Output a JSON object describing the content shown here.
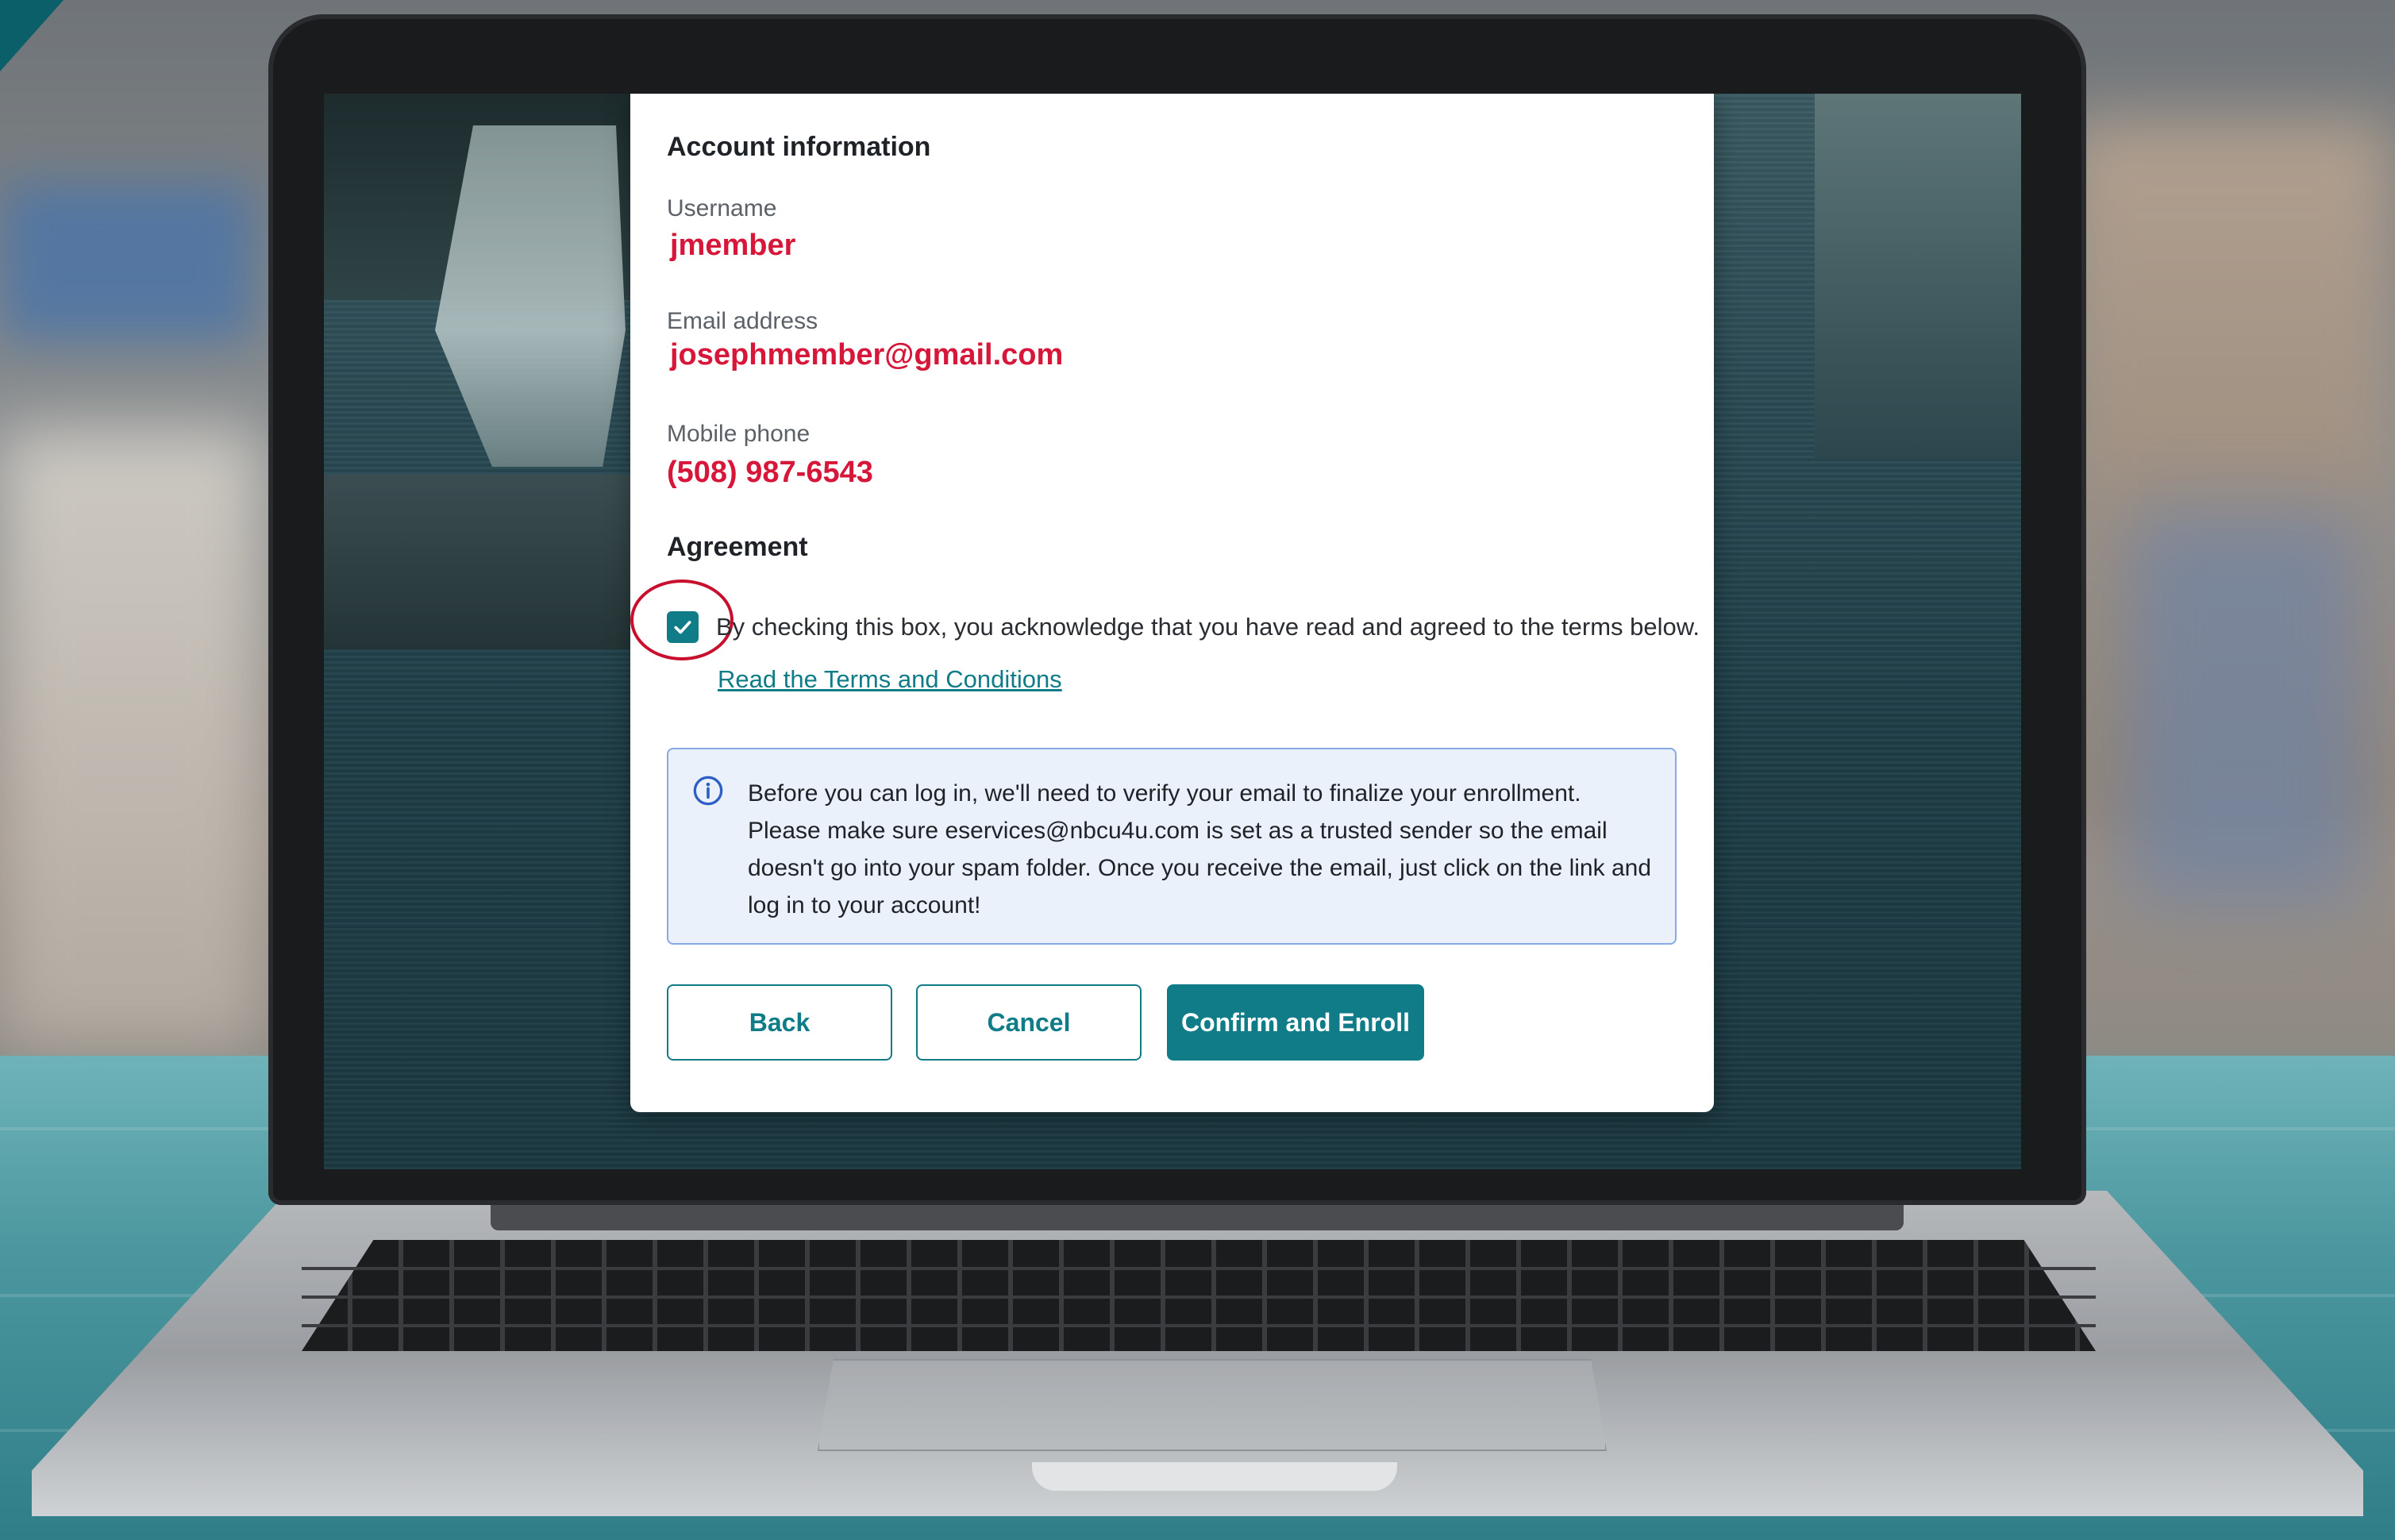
{
  "account": {
    "section_title": "Account information",
    "username_label": "Username",
    "username_value": "jmember",
    "email_label": "Email address",
    "email_value": "josephmember@gmail.com",
    "phone_label": "Mobile phone",
    "phone_value": "(508) 987-6543"
  },
  "agreement": {
    "section_title": "Agreement",
    "checkbox_checked": true,
    "checkbox_text": "By checking this box, you acknowledge that you have read and agreed to the terms below.",
    "terms_link": "Read the Terms and Conditions"
  },
  "info_notice": {
    "icon": "info-icon",
    "text": "Before you can log in, we'll need to verify your email to finalize your enrollment. Please make sure eservices@nbcu4u.com is set as a trusted sender so the email doesn't go into your spam folder. Once you receive the email, just click on the link and log in to your account!"
  },
  "buttons": {
    "back_label": "Back",
    "cancel_label": "Cancel",
    "confirm_label": "Confirm and Enroll"
  },
  "colors": {
    "accent": "#0f7c88",
    "value_text": "#d6173a",
    "highlight_circle": "#c8102e",
    "info_background": "#eaf1fb",
    "info_border": "#87a9e5"
  }
}
